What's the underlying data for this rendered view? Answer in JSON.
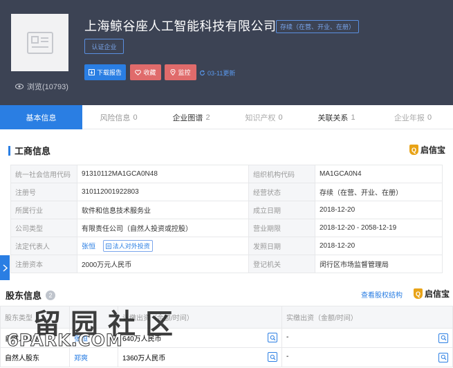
{
  "header": {
    "company_name": "上海鲸谷座人工智能科技有限公司",
    "status_badge": "存续（在营、开业、在册）",
    "verified_badge": "认证企业",
    "views_label": "浏览(10793)",
    "buttons": {
      "download": "下载报告",
      "collect": "收藏",
      "monitor": "监控"
    },
    "update_label": "03-11更新"
  },
  "tabs": [
    {
      "label": "基本信息",
      "count": ""
    },
    {
      "label": "风险信息",
      "count": "0"
    },
    {
      "label": "企业图谱",
      "count": "2"
    },
    {
      "label": "知识产权",
      "count": "0"
    },
    {
      "label": "关联关系",
      "count": "1"
    },
    {
      "label": "企业年报",
      "count": "0"
    }
  ],
  "business_info": {
    "title": "工商信息",
    "brand": "启信宝",
    "rows": [
      {
        "l1": "统一社会信用代码",
        "v1": "91310112MA1GCA0N48",
        "l2": "组织机构代码",
        "v2": "MA1GCA0N4"
      },
      {
        "l1": "注册号",
        "v1": "310112001922803",
        "l2": "经营状态",
        "v2": "存续（在营、开业、在册）"
      },
      {
        "l1": "所属行业",
        "v1": "软件和信息技术服务业",
        "l2": "成立日期",
        "v2": "2018-12-20"
      },
      {
        "l1": "公司类型",
        "v1": "有限责任公司（自然人投资或控股）",
        "l2": "营业期限",
        "v2": "2018-12-20 - 2058-12-19"
      },
      {
        "l1": "法定代表人",
        "v1": "张恒",
        "l2": "发照日期",
        "v2": "2018-12-20"
      },
      {
        "l1": "注册资本",
        "v1": "2000万元人民币",
        "l2": "登记机关",
        "v2": "闵行区市场监督管理局"
      }
    ],
    "legal_rep_tag": "法人对外投资"
  },
  "shareholders": {
    "title": "股东信息",
    "count": "2",
    "equity_link": "查看股权结构",
    "brand": "启信宝",
    "headers": {
      "type": "股东类型",
      "subscribed": "认缴出资（金额/时间）",
      "paid": "实缴出资（金额/时间）"
    },
    "rows": [
      {
        "type": "自然人股东",
        "name": "张恒",
        "amount": "640万人民币",
        "paid": "-"
      },
      {
        "type": "自然人股东",
        "name": "郑爽",
        "amount": "1360万人民币",
        "paid": "-"
      }
    ]
  },
  "watermark": {
    "cn": "留园社区",
    "en": "6PARK.COM"
  }
}
